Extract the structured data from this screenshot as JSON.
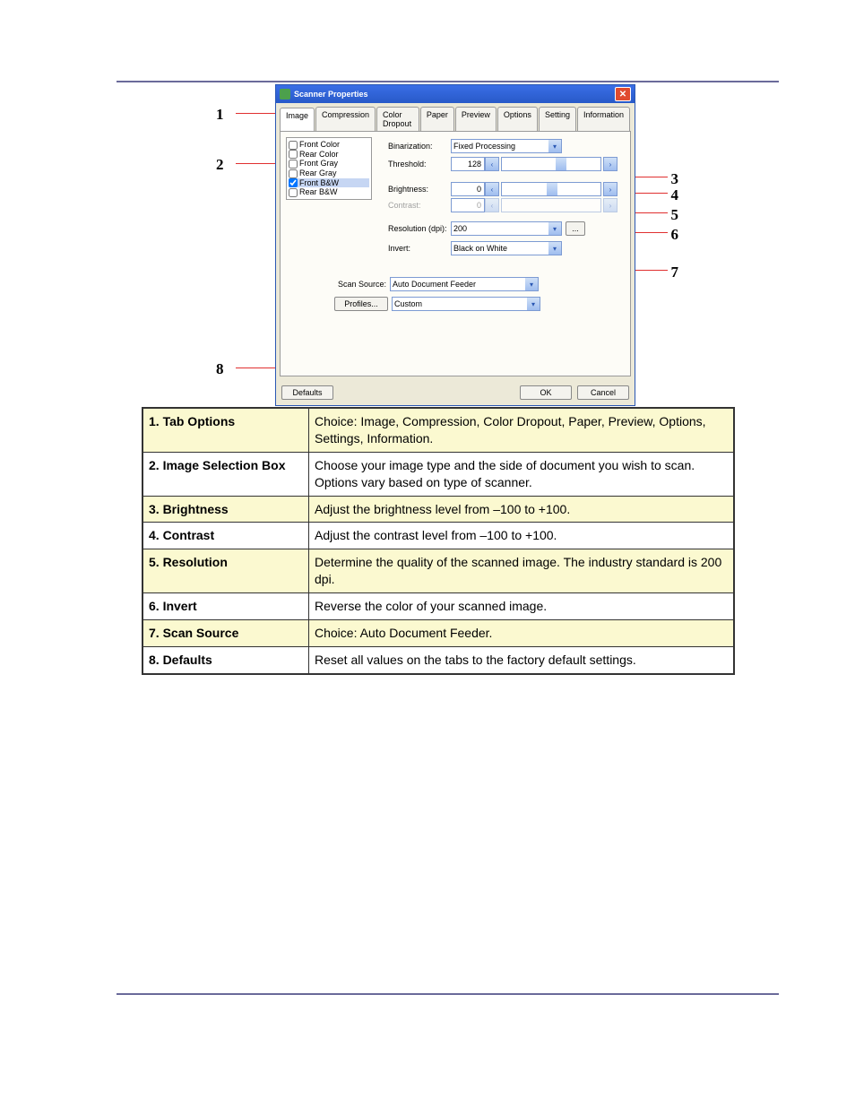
{
  "dlg": {
    "title": "Scanner Properties",
    "tabs": [
      "Image",
      "Compression",
      "Color Dropout",
      "Paper",
      "Preview",
      "Options",
      "Setting",
      "Information"
    ],
    "active_tab": 0,
    "imgsel": {
      "options": [
        {
          "label": "Front Color",
          "checked": false
        },
        {
          "label": "Rear Color",
          "checked": false
        },
        {
          "label": "Front Gray",
          "checked": false
        },
        {
          "label": "Rear Gray",
          "checked": false
        },
        {
          "label": "Front B&W",
          "checked": true
        },
        {
          "label": "Rear B&W",
          "checked": false
        }
      ]
    },
    "binarization_label": "Binarization:",
    "binarization_value": "Fixed Processing",
    "threshold_label": "Threshold:",
    "threshold_value": "128",
    "brightness_label": "Brightness:",
    "brightness_value": "0",
    "contrast_label": "Contrast:",
    "contrast_value": "0",
    "resolution_label": "Resolution (dpi):",
    "resolution_value": "200",
    "resolution_more": "...",
    "invert_label": "Invert:",
    "invert_value": "Black on White",
    "scansource_label": "Scan Source:",
    "scansource_value": "Auto Document Feeder",
    "profiles_btn": "Profiles...",
    "profiles_value": "Custom",
    "defaults_btn": "Defaults",
    "ok_btn": "OK",
    "cancel_btn": "Cancel"
  },
  "callouts": {
    "1": "1",
    "2": "2",
    "3": "3",
    "4": "4",
    "5": "5",
    "6": "6",
    "7": "7",
    "8": "8"
  },
  "table": [
    {
      "term": "1. Tab Options",
      "desc": "Choice: Image, Compression, Color Dropout, Paper, Preview, Options, Settings, Information."
    },
    {
      "term": "2. Image Selection Box",
      "desc": "Choose your image type and the side of document you wish to scan. Options vary based on type of scanner."
    },
    {
      "term": "3. Brightness",
      "desc": "Adjust the brightness level from –100 to +100."
    },
    {
      "term": "4. Contrast",
      "desc": "Adjust the contrast level from –100 to +100."
    },
    {
      "term": "5. Resolution",
      "desc": "Determine the quality of the scanned image. The industry standard is 200 dpi."
    },
    {
      "term": "6. Invert",
      "desc": "Reverse the color of your scanned image."
    },
    {
      "term": "7. Scan Source",
      "desc": "Choice: Auto Document Feeder."
    },
    {
      "term": "8. Defaults",
      "desc": "Reset all values on the tabs to the factory default settings."
    }
  ]
}
